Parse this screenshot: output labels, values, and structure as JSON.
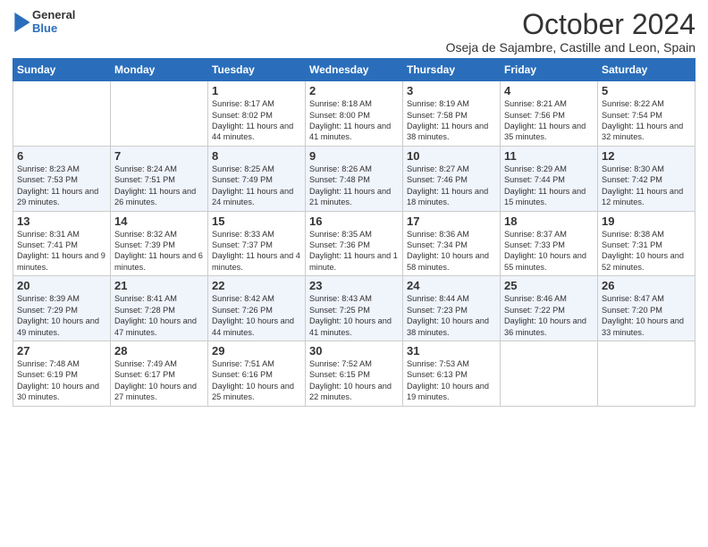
{
  "logo": {
    "general": "General",
    "blue": "Blue"
  },
  "title": "October 2024",
  "location": "Oseja de Sajambre, Castille and Leon, Spain",
  "days_of_week": [
    "Sunday",
    "Monday",
    "Tuesday",
    "Wednesday",
    "Thursday",
    "Friday",
    "Saturday"
  ],
  "weeks": [
    [
      {
        "day": "",
        "info": ""
      },
      {
        "day": "",
        "info": ""
      },
      {
        "day": "1",
        "info": "Sunrise: 8:17 AM\nSunset: 8:02 PM\nDaylight: 11 hours and 44 minutes."
      },
      {
        "day": "2",
        "info": "Sunrise: 8:18 AM\nSunset: 8:00 PM\nDaylight: 11 hours and 41 minutes."
      },
      {
        "day": "3",
        "info": "Sunrise: 8:19 AM\nSunset: 7:58 PM\nDaylight: 11 hours and 38 minutes."
      },
      {
        "day": "4",
        "info": "Sunrise: 8:21 AM\nSunset: 7:56 PM\nDaylight: 11 hours and 35 minutes."
      },
      {
        "day": "5",
        "info": "Sunrise: 8:22 AM\nSunset: 7:54 PM\nDaylight: 11 hours and 32 minutes."
      }
    ],
    [
      {
        "day": "6",
        "info": "Sunrise: 8:23 AM\nSunset: 7:53 PM\nDaylight: 11 hours and 29 minutes."
      },
      {
        "day": "7",
        "info": "Sunrise: 8:24 AM\nSunset: 7:51 PM\nDaylight: 11 hours and 26 minutes."
      },
      {
        "day": "8",
        "info": "Sunrise: 8:25 AM\nSunset: 7:49 PM\nDaylight: 11 hours and 24 minutes."
      },
      {
        "day": "9",
        "info": "Sunrise: 8:26 AM\nSunset: 7:48 PM\nDaylight: 11 hours and 21 minutes."
      },
      {
        "day": "10",
        "info": "Sunrise: 8:27 AM\nSunset: 7:46 PM\nDaylight: 11 hours and 18 minutes."
      },
      {
        "day": "11",
        "info": "Sunrise: 8:29 AM\nSunset: 7:44 PM\nDaylight: 11 hours and 15 minutes."
      },
      {
        "day": "12",
        "info": "Sunrise: 8:30 AM\nSunset: 7:42 PM\nDaylight: 11 hours and 12 minutes."
      }
    ],
    [
      {
        "day": "13",
        "info": "Sunrise: 8:31 AM\nSunset: 7:41 PM\nDaylight: 11 hours and 9 minutes."
      },
      {
        "day": "14",
        "info": "Sunrise: 8:32 AM\nSunset: 7:39 PM\nDaylight: 11 hours and 6 minutes."
      },
      {
        "day": "15",
        "info": "Sunrise: 8:33 AM\nSunset: 7:37 PM\nDaylight: 11 hours and 4 minutes."
      },
      {
        "day": "16",
        "info": "Sunrise: 8:35 AM\nSunset: 7:36 PM\nDaylight: 11 hours and 1 minute."
      },
      {
        "day": "17",
        "info": "Sunrise: 8:36 AM\nSunset: 7:34 PM\nDaylight: 10 hours and 58 minutes."
      },
      {
        "day": "18",
        "info": "Sunrise: 8:37 AM\nSunset: 7:33 PM\nDaylight: 10 hours and 55 minutes."
      },
      {
        "day": "19",
        "info": "Sunrise: 8:38 AM\nSunset: 7:31 PM\nDaylight: 10 hours and 52 minutes."
      }
    ],
    [
      {
        "day": "20",
        "info": "Sunrise: 8:39 AM\nSunset: 7:29 PM\nDaylight: 10 hours and 49 minutes."
      },
      {
        "day": "21",
        "info": "Sunrise: 8:41 AM\nSunset: 7:28 PM\nDaylight: 10 hours and 47 minutes."
      },
      {
        "day": "22",
        "info": "Sunrise: 8:42 AM\nSunset: 7:26 PM\nDaylight: 10 hours and 44 minutes."
      },
      {
        "day": "23",
        "info": "Sunrise: 8:43 AM\nSunset: 7:25 PM\nDaylight: 10 hours and 41 minutes."
      },
      {
        "day": "24",
        "info": "Sunrise: 8:44 AM\nSunset: 7:23 PM\nDaylight: 10 hours and 38 minutes."
      },
      {
        "day": "25",
        "info": "Sunrise: 8:46 AM\nSunset: 7:22 PM\nDaylight: 10 hours and 36 minutes."
      },
      {
        "day": "26",
        "info": "Sunrise: 8:47 AM\nSunset: 7:20 PM\nDaylight: 10 hours and 33 minutes."
      }
    ],
    [
      {
        "day": "27",
        "info": "Sunrise: 7:48 AM\nSunset: 6:19 PM\nDaylight: 10 hours and 30 minutes."
      },
      {
        "day": "28",
        "info": "Sunrise: 7:49 AM\nSunset: 6:17 PM\nDaylight: 10 hours and 27 minutes."
      },
      {
        "day": "29",
        "info": "Sunrise: 7:51 AM\nSunset: 6:16 PM\nDaylight: 10 hours and 25 minutes."
      },
      {
        "day": "30",
        "info": "Sunrise: 7:52 AM\nSunset: 6:15 PM\nDaylight: 10 hours and 22 minutes."
      },
      {
        "day": "31",
        "info": "Sunrise: 7:53 AM\nSunset: 6:13 PM\nDaylight: 10 hours and 19 minutes."
      },
      {
        "day": "",
        "info": ""
      },
      {
        "day": "",
        "info": ""
      }
    ]
  ]
}
